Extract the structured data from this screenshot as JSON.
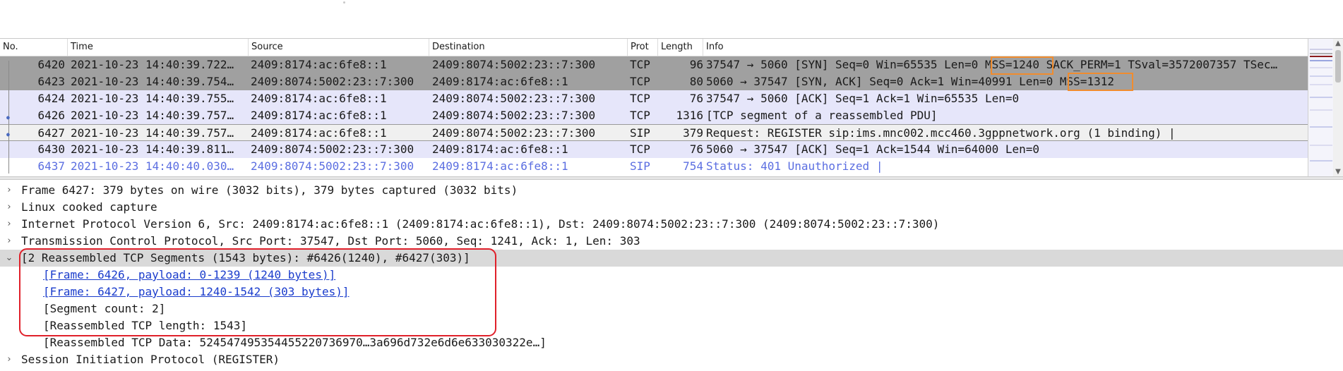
{
  "columns": {
    "no": "No.",
    "time": "Time",
    "source": "Source",
    "destination": "Destination",
    "protocol": "Prot",
    "length": "Length",
    "info": "Info"
  },
  "packets": [
    {
      "no": "6420",
      "time": "2021-10-23 14:40:39.722…",
      "source": "2409:8174:ac:6fe8::1",
      "destination": "2409:8074:5002:23::7:300",
      "protocol": "TCP",
      "length": "96",
      "info": "37547 → 5060 [SYN] Seq=0 Win=65535 Len=0 MSS=1240 SACK_PERM=1 TSval=3572007357 TSec…"
    },
    {
      "no": "6423",
      "time": "2021-10-23 14:40:39.754…",
      "source": "2409:8074:5002:23::7:300",
      "destination": "2409:8174:ac:6fe8::1",
      "protocol": "TCP",
      "length": "80",
      "info": "5060 → 37547 [SYN, ACK] Seq=0 Ack=1 Win=40991 Len=0 MSS=1312"
    },
    {
      "no": "6424",
      "time": "2021-10-23 14:40:39.755…",
      "source": "2409:8174:ac:6fe8::1",
      "destination": "2409:8074:5002:23::7:300",
      "protocol": "TCP",
      "length": "76",
      "info": "37547 → 5060 [ACK] Seq=1 Ack=1 Win=65535 Len=0"
    },
    {
      "no": "6426",
      "time": "2021-10-23 14:40:39.757…",
      "source": "2409:8174:ac:6fe8::1",
      "destination": "2409:8074:5002:23::7:300",
      "protocol": "TCP",
      "length": "1316",
      "info": "[TCP segment of a reassembled PDU]"
    },
    {
      "no": "6427",
      "time": "2021-10-23 14:40:39.757…",
      "source": "2409:8174:ac:6fe8::1",
      "destination": "2409:8074:5002:23::7:300",
      "protocol": "SIP",
      "length": "379",
      "info": "Request: REGISTER sip:ims.mnc002.mcc460.3gppnetwork.org  (1 binding) |"
    },
    {
      "no": "6430",
      "time": "2021-10-23 14:40:39.811…",
      "source": "2409:8074:5002:23::7:300",
      "destination": "2409:8174:ac:6fe8::1",
      "protocol": "TCP",
      "length": "76",
      "info": "5060 → 37547 [ACK] Seq=1 Ack=1544 Win=64000 Len=0"
    },
    {
      "no": "6437",
      "time": "2021-10-23 14:40:40.030…",
      "source": "2409:8074:5002:23::7:300",
      "destination": "2409:8174:ac:6fe8::1",
      "protocol": "SIP",
      "length": "754",
      "info": "Status: 401 Unauthorized |"
    }
  ],
  "details": [
    {
      "text": "Frame 6427: 379 bytes on wire (3032 bits), 379 bytes captured (3032 bits)",
      "expander": "›"
    },
    {
      "text": "Linux cooked capture",
      "expander": "›"
    },
    {
      "text": "Internet Protocol Version 6, Src: 2409:8174:ac:6fe8::1 (2409:8174:ac:6fe8::1), Dst: 2409:8074:5002:23::7:300 (2409:8074:5002:23::7:300)",
      "expander": "›"
    },
    {
      "text": "Transmission Control Protocol, Src Port: 37547, Dst Port: 5060, Seq: 1241, Ack: 1, Len: 303",
      "expander": "›"
    },
    {
      "text": "[2 Reassembled TCP Segments (1543 bytes): #6426(1240), #6427(303)]",
      "expander": "⌄"
    },
    {
      "text": "[Frame: 6426, payload: 0-1239 (1240 bytes)]",
      "expander": ""
    },
    {
      "text": "[Frame: 6427, payload: 1240-1542 (303 bytes)]",
      "expander": ""
    },
    {
      "text": "[Segment count: 2]",
      "expander": ""
    },
    {
      "text": "[Reassembled TCP length: 1543]",
      "expander": ""
    },
    {
      "text": "[Reassembled TCP Data: 524547495354455220736970…3a696d732e6d6e633030322e…]",
      "expander": ""
    },
    {
      "text": "Session Initiation Protocol (REGISTER)",
      "expander": "›"
    }
  ],
  "icons": {
    "scroll_up": "scroll-up-arrow-icon",
    "scroll_down": "scroll-down-arrow-icon"
  },
  "colors": {
    "tcp_syn_row": "#a0a0a0",
    "tcp_row": "#e6e6fa",
    "sip_selected_row": "#f0f0f0",
    "sip_text": "#5b6ee1",
    "annotation_orange": "#f08c2e",
    "annotation_red": "#e0202a",
    "link_blue": "#1a3ccc"
  }
}
